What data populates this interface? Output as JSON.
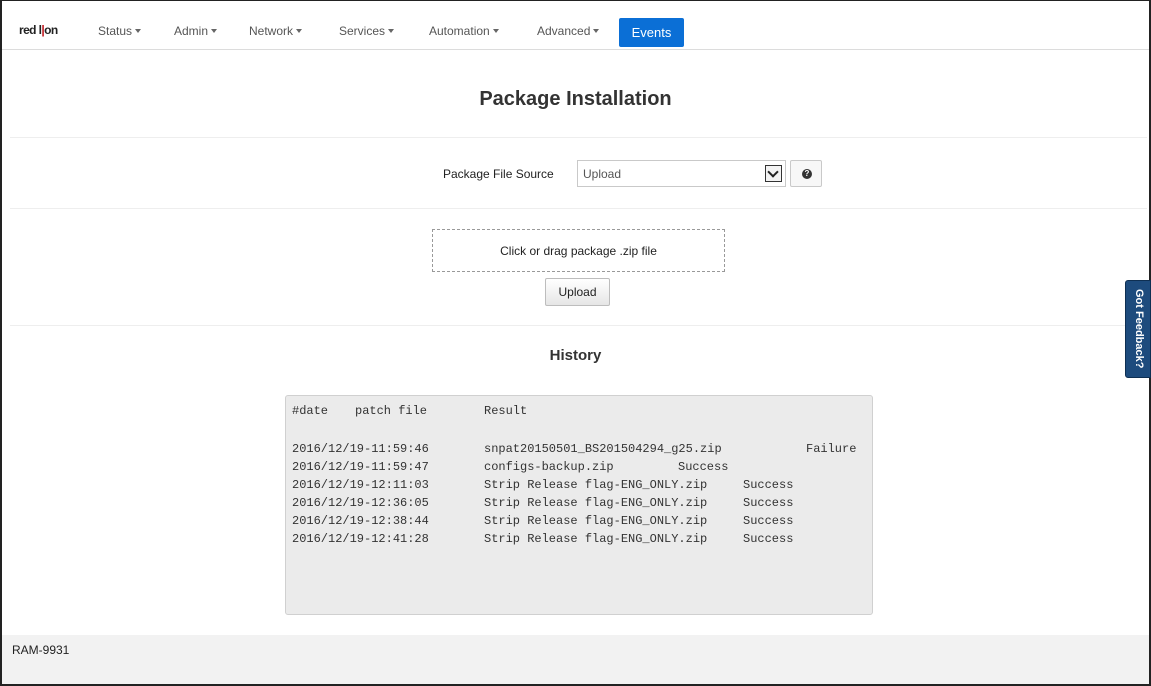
{
  "brand": {
    "logo_text": "red lion"
  },
  "nav": {
    "items": [
      {
        "label": "Status",
        "dropdown": true
      },
      {
        "label": "Admin",
        "dropdown": true
      },
      {
        "label": "Network",
        "dropdown": true
      },
      {
        "label": "Services",
        "dropdown": true
      },
      {
        "label": "Automation",
        "dropdown": true
      },
      {
        "label": "Advanced",
        "dropdown": true
      }
    ],
    "active_label": "Events",
    "active_color": "#0b6fd6"
  },
  "page": {
    "title": "Package Installation",
    "source_label": "Package File Source",
    "source_value": "Upload",
    "help_icon": "question-circle-icon",
    "dropzone_text": "Click or drag package .zip file",
    "upload_button": "Upload",
    "history_title": "History"
  },
  "history": {
    "header": {
      "date": "#date",
      "file": "patch file",
      "result": "Result"
    },
    "rows": [
      {
        "date": "2016/12/19-11:59:46",
        "file": "snpat20150501_BS201504294_g25.zip",
        "result": "Failure"
      },
      {
        "date": "2016/12/19-11:59:47",
        "file": "configs-backup.zip",
        "result": "Success"
      },
      {
        "date": "2016/12/19-12:11:03",
        "file": "Strip Release flag-ENG_ONLY.zip",
        "result": "Success"
      },
      {
        "date": "2016/12/19-12:36:05",
        "file": "Strip Release flag-ENG_ONLY.zip",
        "result": "Success"
      },
      {
        "date": "2016/12/19-12:38:44",
        "file": "Strip Release flag-ENG_ONLY.zip",
        "result": "Success"
      },
      {
        "date": "2016/12/19-12:41:28",
        "file": "Strip Release flag-ENG_ONLY.zip",
        "result": "Success"
      }
    ]
  },
  "footer": {
    "model": "RAM-9931"
  },
  "feedback_tab": {
    "label": "Got Feedback?",
    "color": "#1d4b7d"
  }
}
